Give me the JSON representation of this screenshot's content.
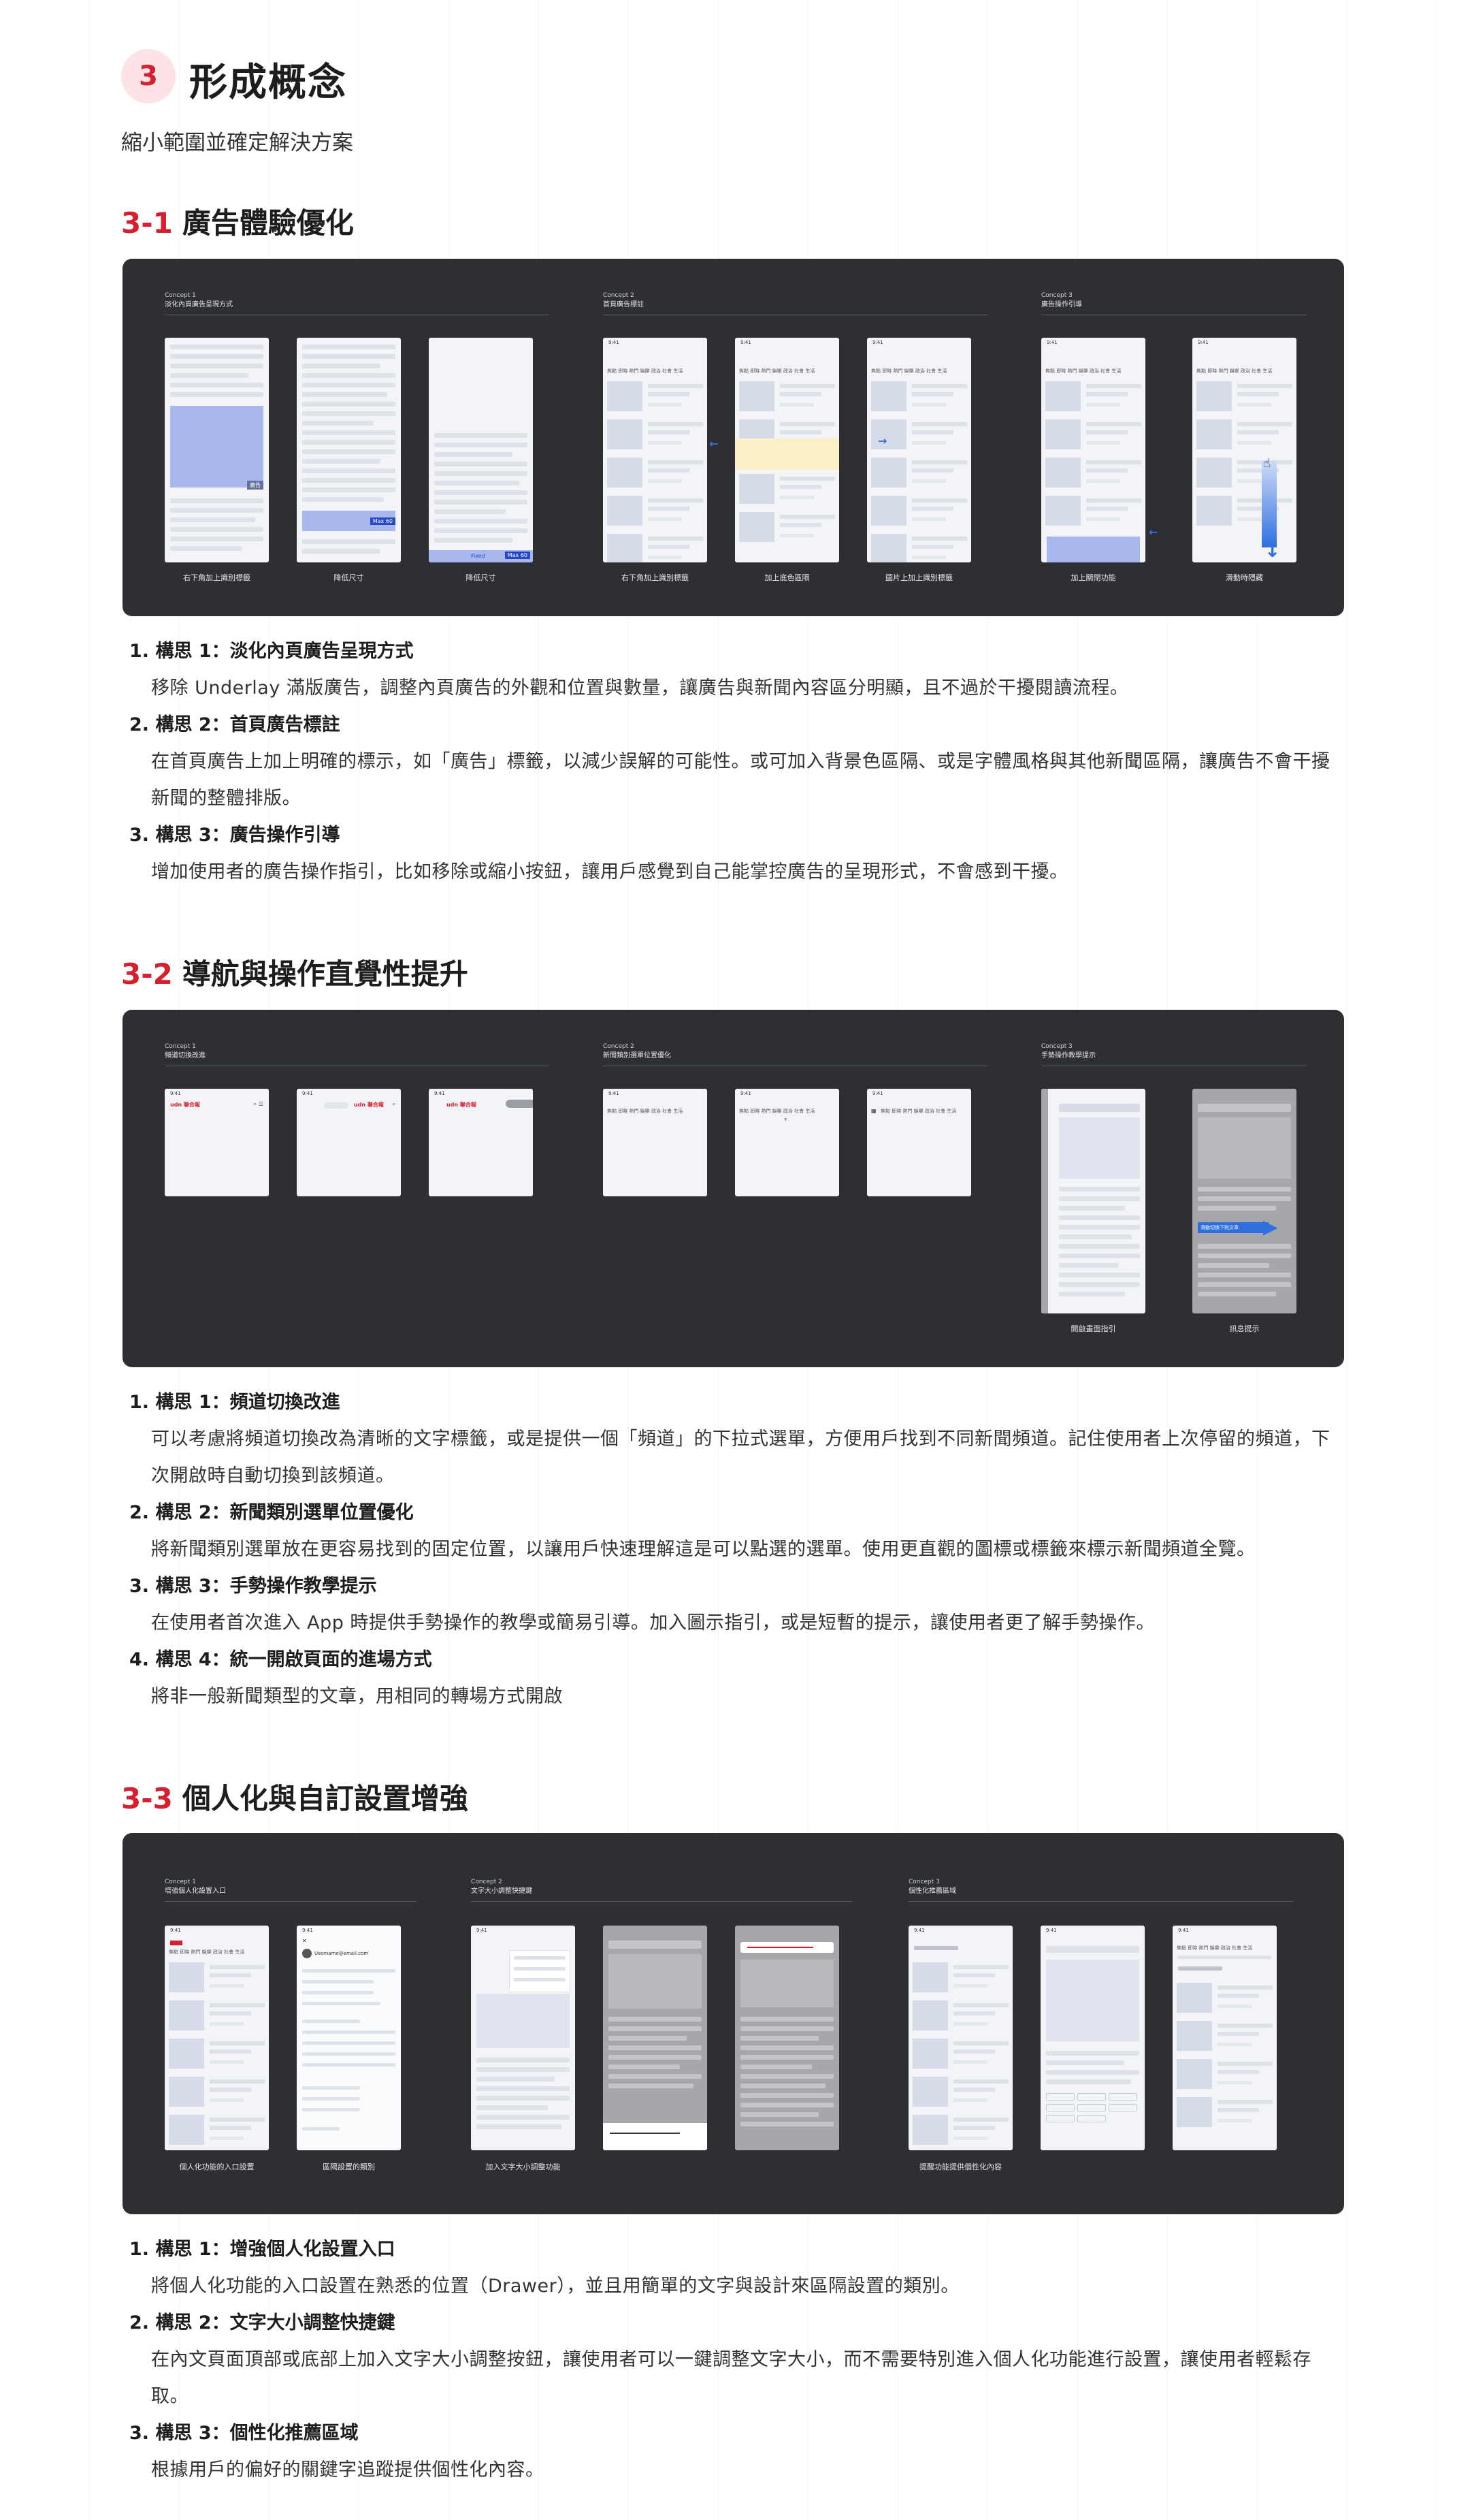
{
  "header": {
    "badge": "3",
    "title": "形成概念",
    "subtitle": "縮小範圍並確定解決方案"
  },
  "sections": [
    {
      "no": "3-1",
      "title": "廣告體驗優化",
      "concepts": [
        {
          "label": "Concept 1",
          "title": "淡化內頁廣告呈現方式"
        },
        {
          "label": "Concept 2",
          "title": "首頁廣告標註"
        },
        {
          "label": "Concept 3",
          "title": "廣告操作引導"
        }
      ],
      "captions": [
        "右下角加上識別標籤",
        "降低尺寸",
        "降低尺寸",
        "右下角加上識別標籤",
        "加上底色區隔",
        "圖片上加上識別標籤",
        "加上關閉功能",
        "滑動時隱藏"
      ],
      "ad_tags": [
        "廣告",
        "Max 60",
        "Fixed",
        "Max 60"
      ],
      "items": [
        {
          "title": "1. 構思 1：淡化內頁廣告呈現方式",
          "body": "移除 Underlay 滿版廣告，調整內頁廣告的外觀和位置與數量，讓廣告與新聞內容區分明顯，且不過於干擾閱讀流程。"
        },
        {
          "title": "2. 構思 2：首頁廣告標註",
          "body": "在首頁廣告上加上明確的標示，如「廣告」標籤，以減少誤解的可能性。或可加入背景色區隔、或是字體風格與其他新聞區隔，讓廣告不會干擾新聞的整體排版。"
        },
        {
          "title": "3. 構思 3：廣告操作引導",
          "body": "增加使用者的廣告操作指引，比如移除或縮小按鈕，讓用戶感覺到自己能掌控廣告的呈現形式，不會感到干擾。"
        }
      ]
    },
    {
      "no": "3-2",
      "title": "導航與操作直覺性提升",
      "concepts": [
        {
          "label": "Concept 1",
          "title": "頻道切換改進"
        },
        {
          "label": "Concept 2",
          "title": "新聞類別選單位置優化"
        },
        {
          "label": "Concept 3",
          "title": "手勢操作教學提示"
        }
      ],
      "captions": [
        "開啟畫面指引",
        "訊息提示"
      ],
      "hint_text": "滑動切換下則文章",
      "items": [
        {
          "title": "1. 構思 1：頻道切換改進",
          "body": "可以考慮將頻道切換改為清晰的文字標籤，或是提供一個「頻道」的下拉式選單，方便用戶找到不同新聞頻道。記住使用者上次停留的頻道，下次開啟時自動切換到該頻道。"
        },
        {
          "title": "2. 構思 2：新聞類別選單位置優化",
          "body": "將新聞類別選單放在更容易找到的固定位置，以讓用戶快速理解這是可以點選的選單。使用更直觀的圖標或標籤來標示新聞頻道全覽。"
        },
        {
          "title": "3. 構思 3：手勢操作教學提示",
          "body": "在使用者首次進入 App 時提供手勢操作的教學或簡易引導。加入圖示指引，或是短暫的提示，讓使用者更了解手勢操作。"
        },
        {
          "title": "4. 構思 4：統一開啟頁面的進場方式",
          "body": "將非一般新聞類型的文章，用相同的轉場方式開啟"
        }
      ]
    },
    {
      "no": "3-3",
      "title": "個人化與自訂設置增強",
      "concepts": [
        {
          "label": "Concept 1",
          "title": "增強個人化設置入口"
        },
        {
          "label": "Concept 2",
          "title": "文字大小調整快捷鍵"
        },
        {
          "label": "Concept 3",
          "title": "個性化推薦區域"
        }
      ],
      "captions": [
        "個人化功能的入口設置",
        "區隔設置的類別",
        "加入文字大小調整功能",
        "提醒功能提供個性化內容"
      ],
      "drawer_email": "Username@email.com",
      "items": [
        {
          "title": "1. 構思 1：增強個人化設置入口",
          "body": "將個人化功能的入口設置在熟悉的位置（Drawer），並且用簡單的文字與設計來區隔設置的類別。"
        },
        {
          "title": "2. 構思 2：文字大小調整快捷鍵",
          "body": "在內文頁面頂部或底部上加入文字大小調整按鈕，讓使用者可以一鍵調整文字大小，而不需要特別進入個人化功能進行設置，讓使用者輕鬆存取。"
        },
        {
          "title": "3. 構思 3：個性化推薦區域",
          "body": "根據用戶的偏好的關鍵字追蹤提供個性化內容。"
        }
      ]
    }
  ],
  "phone_ui": {
    "time": "9:41",
    "tabs": "焦點 即時 熱門 娛樂 政治 社會 生活",
    "active_tab": "焦點",
    "logo": "udn 聯合報"
  },
  "colors": {
    "accent": "#d6202f",
    "panel": "#2d2f33",
    "highlight": "#fbf0c8",
    "blue": "#2f6fe0"
  }
}
